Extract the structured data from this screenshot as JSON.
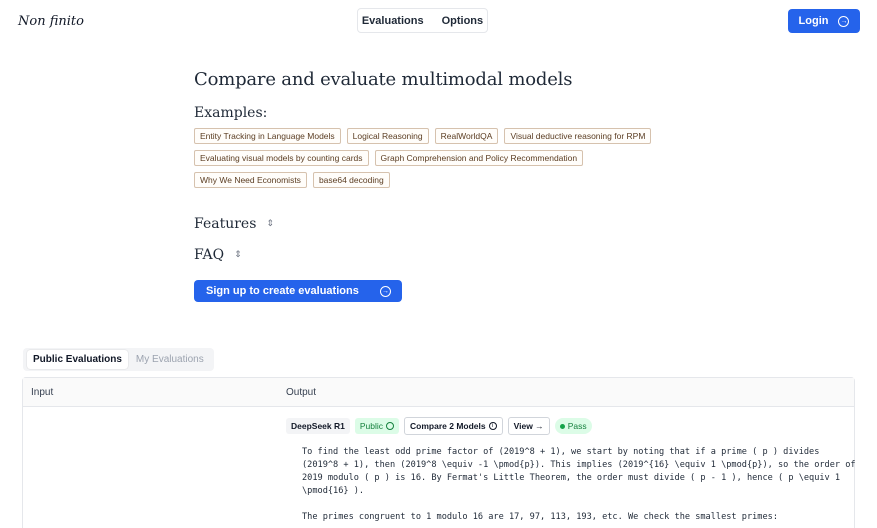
{
  "header": {
    "logo": "Non finito",
    "nav": [
      "Evaluations",
      "Options"
    ],
    "login_label": "Login"
  },
  "hero": {
    "title": "Compare and evaluate multimodal models",
    "examples_heading": "Examples:",
    "examples": [
      [
        "Entity Tracking in Language Models",
        "Logical Reasoning",
        "RealWorldQA",
        "Visual deductive reasoning for RPM"
      ],
      [
        "Evaluating visual models by counting cards",
        "Graph Comprehension and Policy Recommendation"
      ],
      [
        "Why We Need Economists",
        "base64 decoding"
      ]
    ],
    "features_label": "Features",
    "faq_label": "FAQ",
    "signup_label": "Sign up to create evaluations"
  },
  "tabs": [
    "Public Evaluations",
    "My Evaluations"
  ],
  "table": {
    "headers": [
      "Input",
      "Output"
    ],
    "row": {
      "model": "DeepSeek R1",
      "public_label": "Public",
      "compare_label": "Compare 2 Models",
      "view_label": "View →",
      "status": "Pass",
      "output_paragraphs": [
        "To find the least odd prime factor of (2019^8 + 1), we start by noting that if a prime ( p ) divides (2019^8 + 1), then (2019^8 \\equiv -1 \\pmod{p}). This implies (2019^{16} \\equiv 1 \\pmod{p}), so the order of 2019 modulo ( p ) is 16. By Fermat's Little Theorem, the order must divide ( p - 1 ), hence ( p \\equiv 1 \\pmod{16} ).",
        "The primes congruent to 1 modulo 16 are 17, 97, 113, 193, etc. We check the smallest primes:"
      ]
    }
  },
  "colors": {
    "accent": "#2563eb",
    "tag_border": "#d6c2ae",
    "pass_bg": "#dcfce7"
  }
}
